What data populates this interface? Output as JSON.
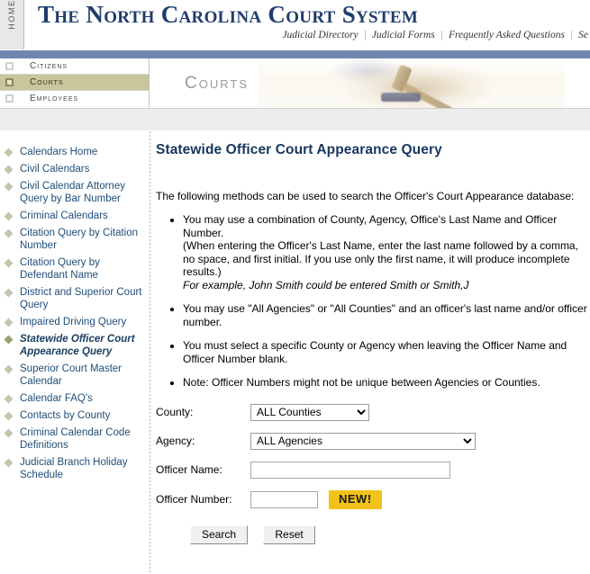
{
  "header": {
    "home_label": "HOME",
    "site_title": "The North Carolina Court System",
    "top_links": [
      {
        "label": "Judicial Directory"
      },
      {
        "label": "Judicial Forms"
      },
      {
        "label": "Frequently Asked Questions"
      },
      {
        "label": "Se"
      }
    ],
    "separator": "|"
  },
  "section_tabs": [
    {
      "label": "Citizens",
      "active": false
    },
    {
      "label": "Courts",
      "active": true
    },
    {
      "label": "Employees",
      "active": false
    }
  ],
  "banner": {
    "title": "Courts"
  },
  "sidebar": {
    "items": [
      {
        "label": "Calendars Home",
        "active": false
      },
      {
        "label": "Civil Calendars",
        "active": false
      },
      {
        "label": "Civil Calendar Attorney Query by Bar Number",
        "active": false
      },
      {
        "label": "Criminal Calendars",
        "active": false
      },
      {
        "label": "Citation Query by Citation Number",
        "active": false
      },
      {
        "label": "Citation Query by Defendant Name",
        "active": false
      },
      {
        "label": "District and Superior Court Query",
        "active": false
      },
      {
        "label": "Impaired Driving Query",
        "active": false
      },
      {
        "label": "Statewide Officer Court Appearance Query",
        "active": true
      },
      {
        "label": "Superior Court Master Calendar",
        "active": false
      },
      {
        "label": "Calendar FAQ's",
        "active": false
      },
      {
        "label": "Contacts by County",
        "active": false
      },
      {
        "label": "Criminal Calendar Code Definitions",
        "active": false
      },
      {
        "label": "Judicial Branch Holiday Schedule",
        "active": false
      }
    ]
  },
  "main": {
    "title": "Statewide Officer Court Appearance Query",
    "intro": "The following methods can be used to search the Officer's Court Appearance database:",
    "bullets": [
      {
        "lines": [
          "You may use a combination of County, Agency, Office's Last Name and Officer Number.",
          "(When entering the Officer's Last Name, enter the last name followed by a comma, no space, and first initial. If you use only the first name, it will produce incomplete results.)"
        ],
        "italic_line": "For example, John Smith could be entered Smith or Smith,J"
      },
      {
        "lines": [
          "You may use \"All Agencies\" or \"All Counties\" and an officer's last name and/or officer number."
        ],
        "italic_line": ""
      },
      {
        "lines": [
          "You must select a specific County or Agency when leaving the Officer Name and Officer Number blank."
        ],
        "italic_line": ""
      },
      {
        "lines": [
          "Note: Officer Numbers might not be unique between Agencies or Counties."
        ],
        "italic_line": ""
      }
    ]
  },
  "form": {
    "county": {
      "label": "County:",
      "value": "ALL Counties",
      "options": [
        "ALL Counties"
      ]
    },
    "agency": {
      "label": "Agency:",
      "value": "ALL Agencies",
      "options": [
        "ALL Agencies"
      ]
    },
    "officer_name": {
      "label": "Officer Name:",
      "value": "",
      "placeholder": ""
    },
    "officer_number": {
      "label": "Officer Number:",
      "value": "",
      "placeholder": ""
    },
    "new_badge": "NEW!",
    "search_label": "Search",
    "reset_label": "Reset"
  },
  "colors": {
    "brand_navy": "#1f3c6e",
    "blue_bar": "#6f87b0",
    "active_tab": "#c8c69a",
    "link_blue": "#1f4e79",
    "badge_gold": "#f2c218"
  }
}
